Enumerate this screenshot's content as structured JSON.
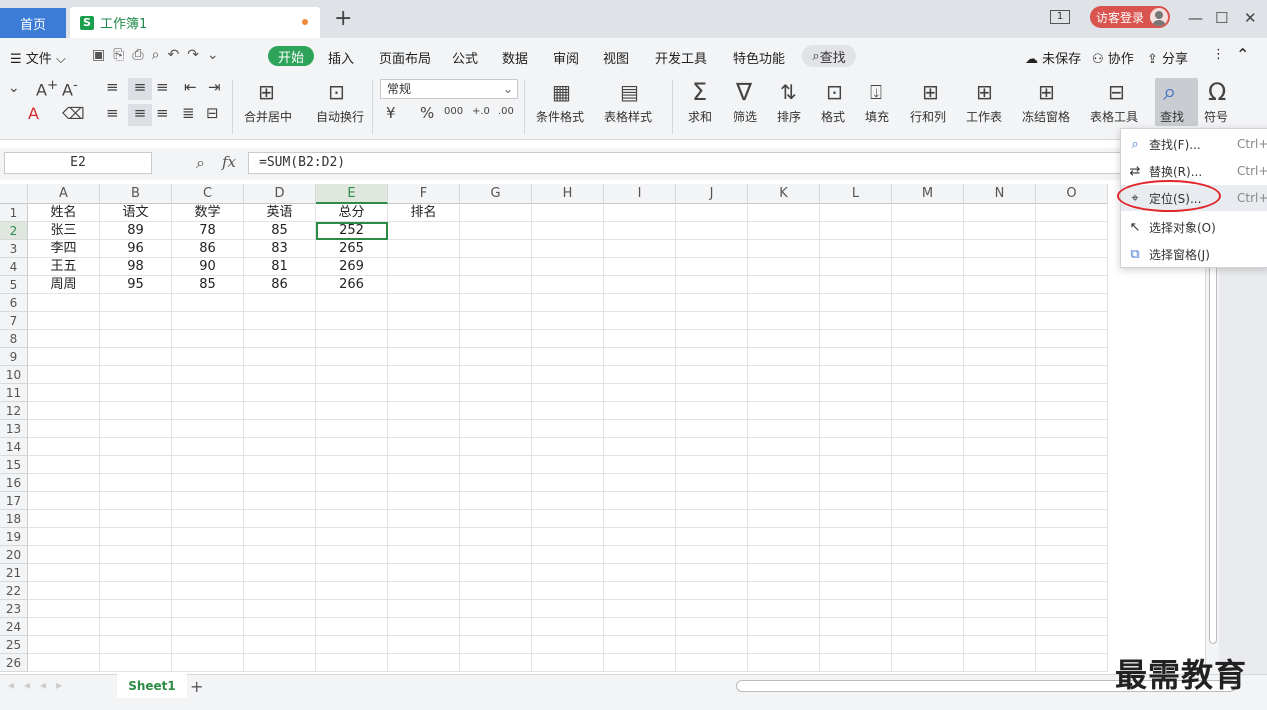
{
  "tabs": {
    "home": "首页",
    "doc": "工作簿1"
  },
  "window": {
    "page_num": "1",
    "login": "访客登录",
    "minimize": "—",
    "maximize": "☐",
    "close": "✕"
  },
  "menu": {
    "file": "文件",
    "start": "开始",
    "items": [
      "插入",
      "页面布局",
      "公式",
      "数据",
      "审阅",
      "视图",
      "开发工具",
      "特色功能"
    ],
    "search": "查找",
    "unsaved": "未保存",
    "collab": "协作",
    "share": "分享"
  },
  "ribbon": {
    "merge": "合并居中",
    "wrap": "自动换行",
    "format_value": "常规",
    "currency": "¥",
    "percent": "%",
    "thousands": "000",
    "inc_dec": "+.0",
    "dec_dec": ".00",
    "cond_format": "条件格式",
    "table_style": "表格样式",
    "sum": "求和",
    "filter": "筛选",
    "sort": "排序",
    "format": "格式",
    "fill": "填充",
    "rowcol": "行和列",
    "worksheet": "工作表",
    "freeze": "冻结窗格",
    "table_tools": "表格工具",
    "find": "查找",
    "symbol": "符号"
  },
  "formula_bar": {
    "name_box": "E2",
    "formula": "=SUM(B2:D2)",
    "fx": "fx"
  },
  "columns": [
    "A",
    "B",
    "C",
    "D",
    "E",
    "F",
    "G",
    "H",
    "I",
    "J",
    "K",
    "L",
    "M",
    "N",
    "O"
  ],
  "rows": [
    "1",
    "2",
    "3",
    "4",
    "5",
    "6",
    "7",
    "8",
    "9",
    "10",
    "11",
    "12",
    "13",
    "14",
    "15",
    "16",
    "17",
    "18",
    "19",
    "20",
    "21",
    "22",
    "23",
    "24",
    "25",
    "26"
  ],
  "table": [
    [
      "姓名",
      "语文",
      "数学",
      "英语",
      "总分",
      "排名"
    ],
    [
      "张三",
      "89",
      "78",
      "85",
      "252",
      ""
    ],
    [
      "李四",
      "96",
      "86",
      "83",
      "265",
      ""
    ],
    [
      "王五",
      "98",
      "90",
      "81",
      "269",
      ""
    ],
    [
      "周周",
      "95",
      "85",
      "86",
      "266",
      ""
    ]
  ],
  "sheet": {
    "name": "Sheet1",
    "add": "+"
  },
  "dropdown": [
    {
      "label": "查找(F)...",
      "shortcut": "Ctrl+"
    },
    {
      "label": "替换(R)...",
      "shortcut": "Ctrl+H"
    },
    {
      "label": "定位(S)...",
      "shortcut": "Ctrl+G"
    },
    {
      "label": "选择对象(O)",
      "shortcut": ""
    },
    {
      "label": "选择窗格(J)",
      "shortcut": ""
    }
  ],
  "watermark": "最需教育",
  "colors": {
    "accent": "#2ea35a",
    "home_tab": "#3c7bd6",
    "login": "#d9534f",
    "highlight": "#e0262b"
  }
}
